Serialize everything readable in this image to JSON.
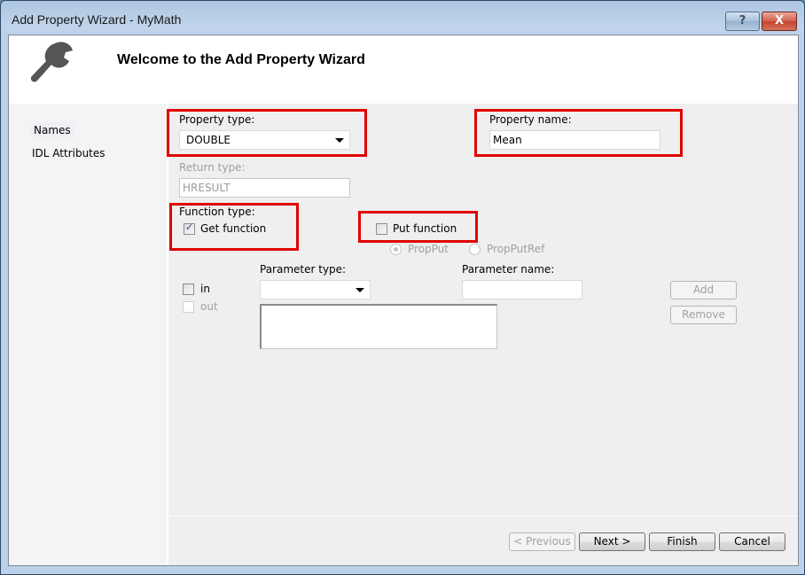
{
  "window": {
    "title": "Add Property Wizard - MyMath",
    "help_button": "?",
    "close_button": "X"
  },
  "header": {
    "icon": "wrench-icon",
    "heading": "Welcome to the Add Property Wizard"
  },
  "nav": {
    "items": [
      {
        "label": "Names",
        "selected": true
      },
      {
        "label": "IDL Attributes",
        "selected": false
      }
    ]
  },
  "form": {
    "property_type": {
      "label": "Property type:",
      "value": "DOUBLE"
    },
    "property_name": {
      "label": "Property name:",
      "value": "Mean"
    },
    "return_type": {
      "label": "Return type:",
      "value": "HRESULT",
      "enabled": false
    },
    "function_type": {
      "label": "Function type:",
      "get_function": {
        "label": "Get function",
        "checked": true
      },
      "put_function": {
        "label": "Put function",
        "checked": false
      },
      "propput": {
        "label": "PropPut",
        "selected": true,
        "enabled": false
      },
      "propputref": {
        "label": "PropPutRef",
        "selected": false,
        "enabled": false
      }
    },
    "parameters": {
      "in": {
        "label": "in",
        "checked": false
      },
      "out": {
        "label": "out",
        "checked": false,
        "enabled": false
      },
      "parameter_type": {
        "label": "Parameter type:",
        "value": ""
      },
      "parameter_name": {
        "label": "Parameter name:",
        "value": ""
      },
      "add_button": "Add",
      "remove_button": "Remove"
    }
  },
  "footer": {
    "previous": "< Previous",
    "next": "Next >",
    "finish": "Finish",
    "cancel": "Cancel"
  },
  "colors": {
    "highlight_box": "#e00000",
    "title_bar": "#bcd1ea"
  }
}
